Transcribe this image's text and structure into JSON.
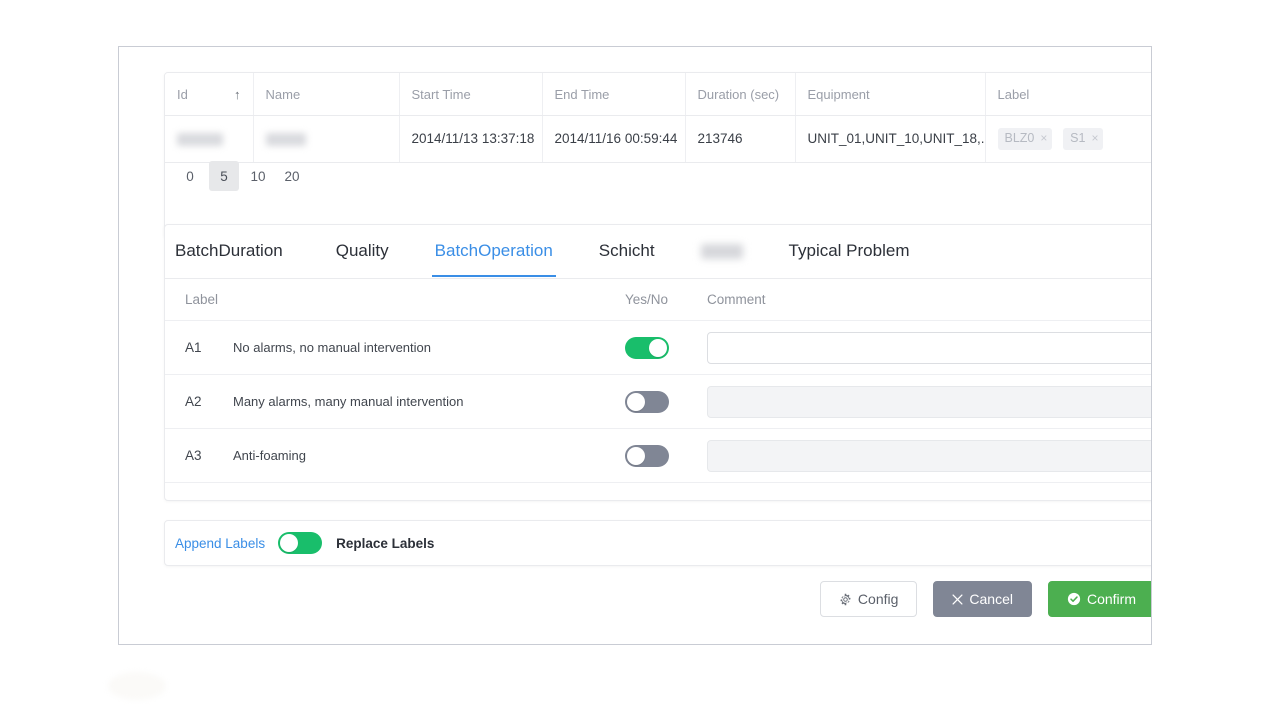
{
  "table": {
    "columns": [
      {
        "key": "id",
        "label": "Id",
        "sort": "asc",
        "sort_icon": "arrow-up-icon"
      },
      {
        "key": "name",
        "label": "Name"
      },
      {
        "key": "start_time",
        "label": "Start Time"
      },
      {
        "key": "end_time",
        "label": "End Time"
      },
      {
        "key": "duration",
        "label": "Duration (sec)"
      },
      {
        "key": "equipment",
        "label": "Equipment"
      },
      {
        "key": "label",
        "label": "Label"
      }
    ],
    "rows": [
      {
        "id": "",
        "name": "",
        "id_redacted": true,
        "name_redacted": true,
        "start_time": "2014/11/13 13:37:18",
        "end_time": "2014/11/16 00:59:44",
        "duration": "213746",
        "equipment": "UNIT_01,UNIT_10,UNIT_18,...",
        "labels": [
          {
            "text": "BLZ0",
            "remove_icon": "×"
          },
          {
            "text": "S1",
            "remove_icon": "×"
          }
        ]
      }
    ]
  },
  "pagination": {
    "options": [
      "0",
      "5",
      "10",
      "20"
    ],
    "selected": "5"
  },
  "tabs": [
    {
      "label": "BatchDuration",
      "active": false,
      "redacted": false
    },
    {
      "label": "Quality",
      "active": false,
      "redacted": false
    },
    {
      "label": "BatchOperation",
      "active": true,
      "redacted": false
    },
    {
      "label": "Schicht",
      "active": false,
      "redacted": false
    },
    {
      "label": "",
      "active": false,
      "redacted": true
    },
    {
      "label": "Typical Problem",
      "active": false,
      "redacted": false
    }
  ],
  "label_table": {
    "headers": {
      "label": "Label",
      "description": "",
      "yes_no": "Yes/No",
      "comment": "Comment"
    },
    "rows": [
      {
        "label": "A1",
        "description": "No alarms, no manual intervention",
        "toggle_on": true,
        "comment_value": "",
        "comment_placeholder": "",
        "comment_disabled": false
      },
      {
        "label": "A2",
        "description": "Many alarms, many manual intervention",
        "toggle_on": false,
        "comment_value": "",
        "comment_placeholder": "",
        "comment_disabled": true
      },
      {
        "label": "A3",
        "description": "Anti-foaming",
        "toggle_on": false,
        "comment_value": "",
        "comment_placeholder": "",
        "comment_disabled": true
      }
    ]
  },
  "label_mode": {
    "append_label": "Append Labels",
    "replace_label": "Replace Labels",
    "toggle_on": false
  },
  "footer": {
    "config_label": "Config",
    "config_icon": "gear-icon",
    "cancel_label": "Cancel",
    "cancel_icon": "close-icon",
    "confirm_label": "Confirm",
    "confirm_icon": "check-circle-icon"
  },
  "colors": {
    "accent_blue": "#3a8ee6",
    "toggle_on_green": "#19be6b",
    "toggle_off_grey": "#808695",
    "confirm_green": "#4caf50",
    "cancel_grey": "#808695",
    "border": "#eaebee"
  }
}
